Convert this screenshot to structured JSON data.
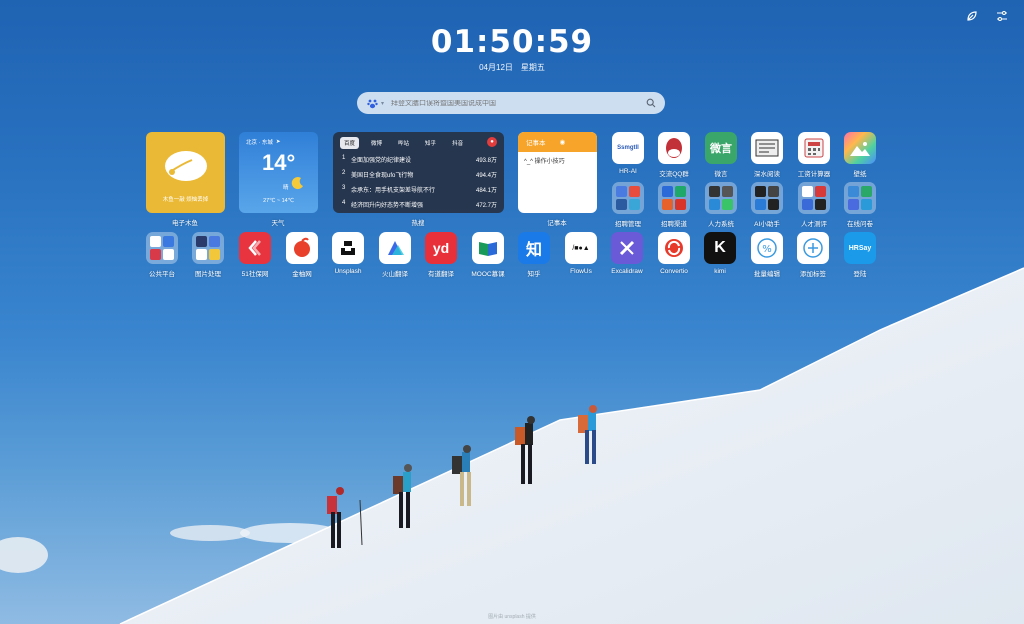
{
  "clock": {
    "time": "01:50:59",
    "date": "04月12日",
    "weekday": "星期五"
  },
  "search": {
    "placeholder": "拜登文膳口误将暨国美国说成中国"
  },
  "widgets": {
    "fish": {
      "label": "电子木鱼",
      "caption": "木鱼一敲 烦恼丢掉"
    },
    "weather": {
      "label": "天气",
      "city": "北京 · 东城",
      "temp": "14°",
      "cond": "晴",
      "range": "27℃ ~ 14℃"
    },
    "hot": {
      "label": "热搜",
      "tabs": [
        "百度",
        "微博",
        "哔站",
        "知乎",
        "抖音"
      ],
      "items": [
        {
          "no": "1",
          "title": "全面加强党的纪律建设",
          "count": "493.8万"
        },
        {
          "no": "2",
          "title": "美国日全食现ufo飞行物",
          "count": "494.4万"
        },
        {
          "no": "3",
          "title": "余承东：用手机支架差导航不行",
          "count": "484.1万"
        },
        {
          "no": "4",
          "title": "经济回升向好态势不断增强",
          "count": "472.7万"
        }
      ]
    },
    "note": {
      "label": "记事本",
      "title": "记事本",
      "body": "^_^ 操作小技巧"
    }
  },
  "apps_row1": [
    {
      "name": "HR-AI",
      "label": "HR-AI"
    },
    {
      "name": "qq",
      "label": "交流QQ群"
    },
    {
      "name": "weiyan",
      "label": "微言"
    },
    {
      "name": "shenshui",
      "label": "深水阅读"
    },
    {
      "name": "salary",
      "label": "工资计算器"
    },
    {
      "name": "wallpaper",
      "label": "壁纸"
    }
  ],
  "folders_row2": [
    {
      "label": "招聘管理"
    },
    {
      "label": "招聘渠道"
    },
    {
      "label": "人力系统"
    },
    {
      "label": "AI小助手"
    },
    {
      "label": "人才测评"
    },
    {
      "label": "在线问卷"
    }
  ],
  "apps_row3": [
    {
      "label": "公共平台"
    },
    {
      "label": "图片处理"
    },
    {
      "label": "51社保网"
    },
    {
      "label": "金柚网"
    },
    {
      "label": "Unsplash"
    },
    {
      "label": "火山翻译"
    },
    {
      "label": "有道翻译"
    },
    {
      "label": "MOOC慕课"
    },
    {
      "label": "知乎"
    },
    {
      "label": "FlowUs"
    },
    {
      "label": "Excalidraw"
    },
    {
      "label": "Convertio"
    },
    {
      "label": "kimi"
    },
    {
      "label": "批量编辑"
    },
    {
      "label": "添加标签"
    },
    {
      "label": "登陆"
    }
  ],
  "icon_text": {
    "hrai": "Ssmgtll",
    "weiyan": "微言",
    "zhihu": "知",
    "flowus": "/■●▲",
    "kimi": "K",
    "hrsay": "HRSay",
    "youdao": "yd"
  },
  "footer": "图片由 unsplash 提供"
}
